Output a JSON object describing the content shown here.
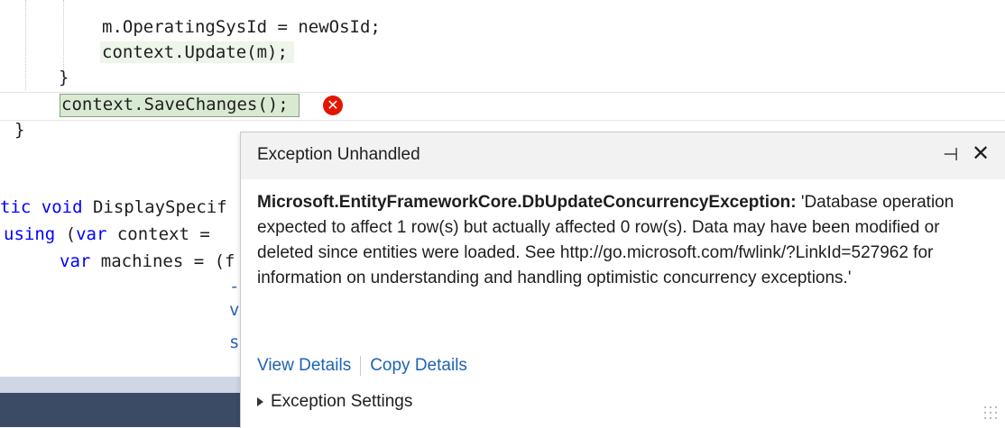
{
  "editor": {
    "lines": {
      "l1": "m.OperatingSysId = newOsId;",
      "l2_obj": "context",
      "l2_rest": ".Update(m);",
      "l3": "}",
      "l4_obj": "context",
      "l4_rest": ".SaveChanges();",
      "l5": "}",
      "l6_kw": "tic void",
      "l6_rest": " DisplaySpecif",
      "l7_kw1": "using",
      "l7_mid": " (",
      "l7_kw2": "var",
      "l7_rest": " context =",
      "l8_kw": "var",
      "l8_rest": " machines = (f",
      "frag1": "-",
      "frag2": "v",
      "frag3": "s"
    },
    "error_glyph": "✕"
  },
  "exception": {
    "title": "Exception Unhandled",
    "pin_icon": "⊣",
    "close_icon": "✕",
    "type": "Microsoft.EntityFrameworkCore.DbUpdateConcurrencyException:",
    "message": " 'Database operation expected to affect 1 row(s) but actually affected 0 row(s). Data may have been modified or deleted since entities were loaded. See http://go.microsoft.com/fwlink/?LinkId=527962 for information on understanding and handling optimistic concurrency exceptions.'",
    "view_details": "View Details",
    "copy_details": "Copy Details",
    "settings": "Exception Settings"
  }
}
